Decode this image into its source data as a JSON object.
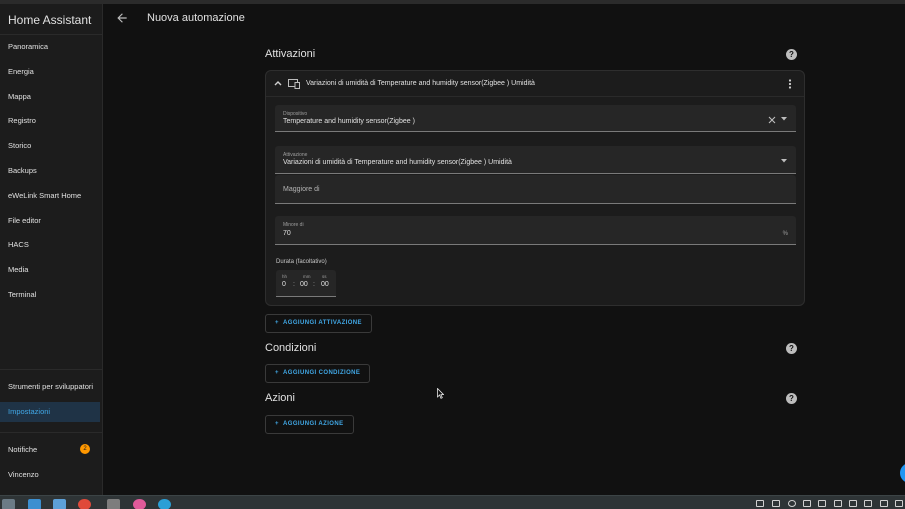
{
  "app": {
    "title": "Home Assistant"
  },
  "sidebar": {
    "items": [
      {
        "label": "Panoramica"
      },
      {
        "label": "Energia"
      },
      {
        "label": "Mappa"
      },
      {
        "label": "Registro"
      },
      {
        "label": "Storico"
      },
      {
        "label": "Backups"
      },
      {
        "label": "eWeLink Smart Home"
      },
      {
        "label": "File editor"
      },
      {
        "label": "HACS"
      },
      {
        "label": "Media"
      },
      {
        "label": "Terminal"
      }
    ],
    "bottom_items": [
      {
        "label": "Strumenti per sviluppatori"
      },
      {
        "label": "Impostazioni"
      }
    ],
    "notifications": {
      "label": "Notifiche",
      "count": "2"
    },
    "user": {
      "label": "Vincenzo"
    }
  },
  "header": {
    "title": "Nuova automazione"
  },
  "triggers": {
    "title": "Attivazioni",
    "card": {
      "title": "Variazioni di umidità di Temperature and humidity sensor(Zigbee ) Umidità",
      "device_field": {
        "label": "Dispositivo",
        "value": "Temperature and humidity sensor(Zigbee )"
      },
      "trigger_field": {
        "label": "Attivazione",
        "value": "Variazioni di umidità di Temperature and humidity sensor(Zigbee ) Umidità"
      },
      "above_field": {
        "placeholder": "Maggiore di"
      },
      "below_field": {
        "label": "Minore di",
        "value": "70",
        "unit": "%"
      },
      "duration": {
        "label": "Durata (facoltativo)",
        "hh_label": "hh",
        "mm_label": "mm",
        "ss_label": "ss",
        "hh": "0",
        "mm": "00",
        "ss": "00"
      }
    },
    "add_label": "AGGIUNGI ATTIVAZIONE"
  },
  "conditions": {
    "title": "Condizioni",
    "add_label": "AGGIUNGI CONDIZIONE"
  },
  "actions": {
    "title": "Azioni",
    "add_label": "AGGIUNGI AZIONE"
  },
  "icons": {
    "back": "arrow-left-icon",
    "help": "help-circle-icon",
    "collapse": "chevron-up-icon",
    "device": "devices-icon",
    "menu": "dots-vertical-icon",
    "clear": "close-icon",
    "dropdown": "menu-down-icon",
    "add": "plus-icon"
  },
  "colors": {
    "accent": "#41a8e6",
    "badge": "#ff9800",
    "background": "#111111",
    "card": "#1c1c1c"
  }
}
